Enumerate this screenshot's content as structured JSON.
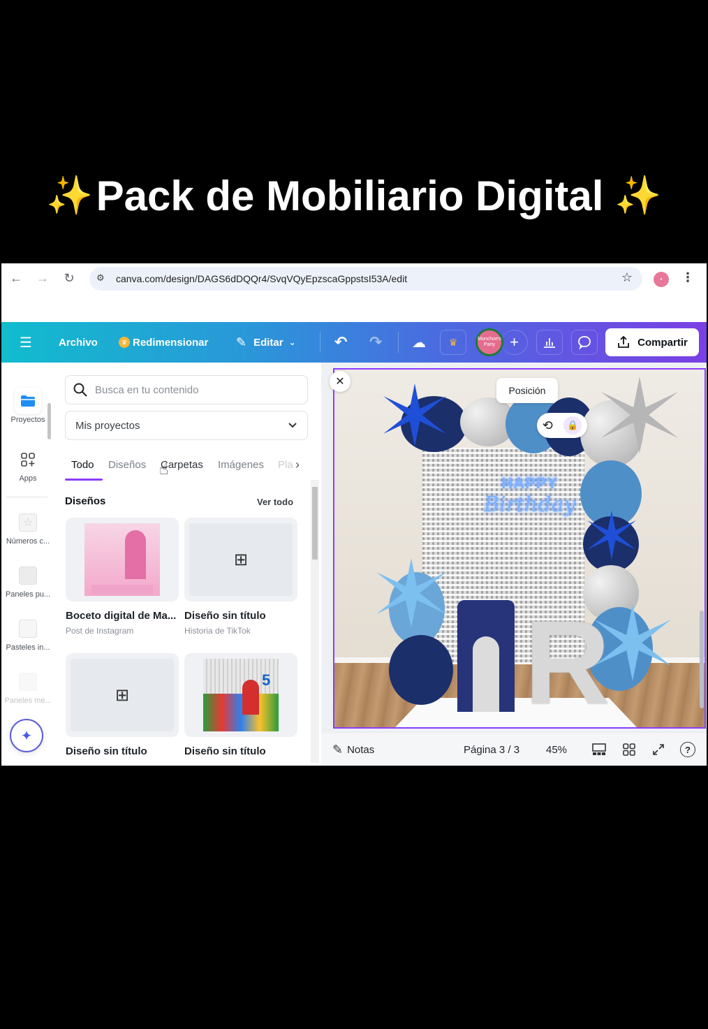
{
  "caption": {
    "title": "Pack de Mobiliario Digital",
    "sparkle_icon": "✨"
  },
  "browser": {
    "url": "canva.com/design/DAGS6dDQQr4/SvqVQyEpzscaGppstsI53A/edit",
    "back_icon": "←",
    "forward_icon": "→",
    "reload_icon": "↻",
    "site_info_icon": "⚙",
    "bookmark_icon": "☆",
    "menu_icon": "⋮"
  },
  "toolbar": {
    "menu_icon": "☰",
    "file_label": "Archivo",
    "resize_label": "Redimensionar",
    "edit_label": "Editar",
    "undo_icon": "↶",
    "redo_icon": "↷",
    "save_icon": "☁",
    "crown_icon": "♛",
    "collaborator_initials": "Monchoe's Party",
    "add_icon": "+",
    "insights_icon": "📊",
    "comment_icon": "💬",
    "share_label": "Compartir",
    "accent_gradient_start": "#11bccd",
    "accent_gradient_end": "#7b3fe4"
  },
  "rail": {
    "items": [
      {
        "label": "Proyectos",
        "icon": "folder"
      },
      {
        "label": "Apps",
        "icon": "apps"
      },
      {
        "label": "Números c...",
        "icon": "star"
      },
      {
        "label": "Paneles pu...",
        "icon": "square"
      },
      {
        "label": "Pasteles in...",
        "icon": "square"
      },
      {
        "label": "Paneles me...",
        "icon": "square"
      }
    ],
    "magic_icon": "✦"
  },
  "panel": {
    "search_placeholder": "Busca en tu contenido",
    "dropdown_value": "Mis proyectos",
    "tabs": [
      "Todo",
      "Diseños",
      "Carpetas",
      "Imágenes",
      "Pla"
    ],
    "active_tab": "Todo",
    "section_title": "Diseños",
    "see_all": "Ver todo",
    "designs": [
      {
        "title": "Boceto digital de Ma...",
        "subtitle": "Post de Instagram"
      },
      {
        "title": "Diseño sin título",
        "subtitle": "Historia de TikTok"
      },
      {
        "title": "Diseño sin título",
        "subtitle": ""
      },
      {
        "title": "Diseño sin título",
        "subtitle": ""
      }
    ]
  },
  "canvas": {
    "close_icon": "✕",
    "position_label": "Posición",
    "neon_line1": "HAPPY",
    "neon_line2": "Birthday",
    "letter": "R"
  },
  "bottom_bar": {
    "notes_label": "Notas",
    "page_indicator": "Página 3 / 3",
    "zoom": "45%",
    "help_icon": "?"
  }
}
